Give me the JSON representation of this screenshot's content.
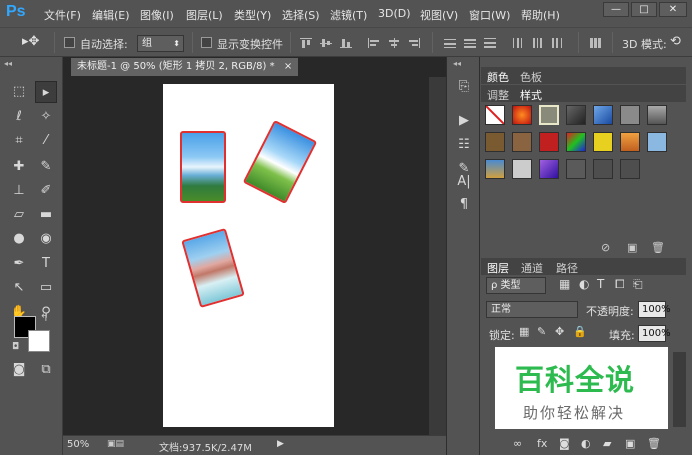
{
  "app": {
    "logo": "Ps"
  },
  "menu": [
    "文件(F)",
    "编辑(E)",
    "图像(I)",
    "图层(L)",
    "类型(Y)",
    "选择(S)",
    "滤镜(T)",
    "3D(D)",
    "视图(V)",
    "窗口(W)",
    "帮助(H)"
  ],
  "window_controls": {
    "minimize": "—",
    "restore": "□",
    "close": "✕"
  },
  "options": {
    "auto_select_label": "自动选择:",
    "auto_select_value": "组",
    "show_transform_label": "显示变换控件",
    "mode_label": "3D 模式:"
  },
  "document": {
    "tab_title": "未标题-1 @ 50% (矩形 1 拷贝 2, RGB/8) *",
    "tab_close": "×",
    "zoom": "50%",
    "doc_info": "文档:937.5K/2.47M"
  },
  "toolbox": {
    "tools": [
      "move-tool",
      "lasso-tool",
      "magic-wand-tool",
      "crop-tool",
      "eyedropper-tool",
      "healing-tool",
      "brush-tool",
      "stamp-tool",
      "history-brush-tool",
      "eraser-tool",
      "gradient-tool",
      "blur-tool",
      "dodge-tool",
      "pen-tool",
      "type-tool",
      "path-select-tool",
      "rectangle-tool",
      "hand-tool",
      "zoom-tool"
    ],
    "foreground_color": "#000000",
    "background_color": "#ffffff"
  },
  "panels": {
    "color_tabs": [
      "颜色",
      "色板"
    ],
    "style_tabs": [
      "调整",
      "样式"
    ],
    "layers_tabs": [
      "图层",
      "通道",
      "路径"
    ],
    "layers": {
      "filter_label": "ρ 类型",
      "blend_mode": "正常",
      "opacity_label": "不透明度:",
      "opacity_value": "100%",
      "lock_label": "锁定:",
      "fill_label": "填充:",
      "fill_value": "100%"
    }
  },
  "watermark": {
    "title": "百科全说",
    "subtitle": "助你轻松解决"
  },
  "colors": {
    "accent": "#31a8ff",
    "photo_border": "#e03030",
    "watermark_green": "#2dba4e"
  }
}
